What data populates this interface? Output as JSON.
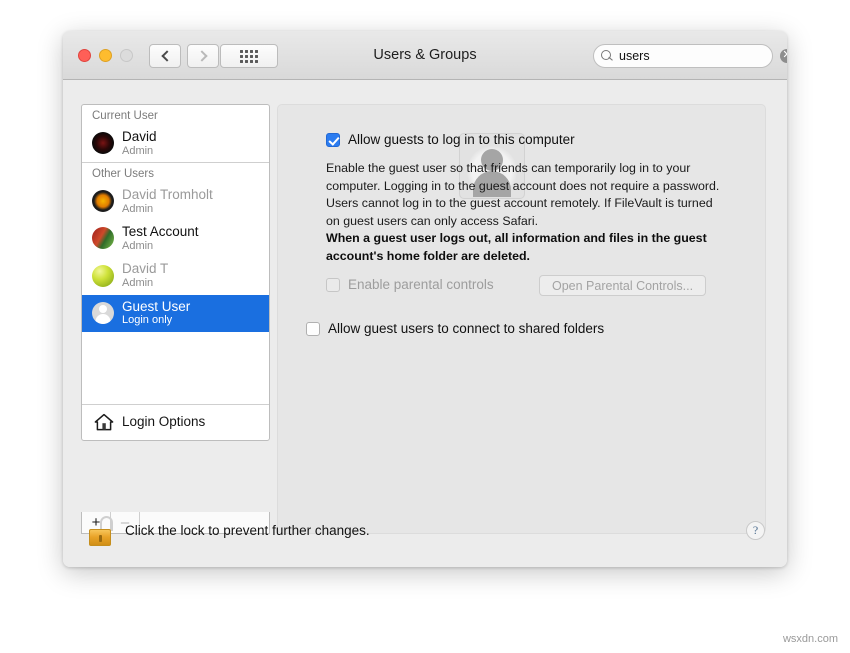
{
  "window": {
    "title": "Users & Groups",
    "traffic_lights": [
      "close",
      "minimize",
      "zoom"
    ]
  },
  "toolbar": {
    "back_label": "‹",
    "forward_label": "›",
    "show_all_label": "grid-icon",
    "search": {
      "value": "users",
      "placeholder": "Search",
      "clear_label": "✕"
    }
  },
  "sidebar": {
    "current_user_header": "Current User",
    "other_users_header": "Other Users",
    "current_user": {
      "name": "David",
      "role": "Admin",
      "avatar": "dark-sphere-avatar"
    },
    "other_users": [
      {
        "name": "David Tromholt",
        "role": "Admin",
        "avatar": "sunflower-avatar",
        "selected": false
      },
      {
        "name": "Test Account",
        "role": "Admin",
        "avatar": "photo-avatar",
        "selected": false
      },
      {
        "name": "David T",
        "role": "Admin",
        "avatar": "green-ball-avatar",
        "selected": false
      },
      {
        "name": "Guest User",
        "role": "Login only",
        "avatar": "guest-silhouette-avatar",
        "selected": true
      }
    ],
    "login_options_label": "Login Options",
    "add_button_label": "+",
    "remove_button_label": "–"
  },
  "main": {
    "avatar_alt": "guest-user-avatar",
    "allow_guests": {
      "label": "Allow guests to log in to this computer",
      "checked": true
    },
    "description": "Enable the guest user so that friends can temporarily log in to your computer. Logging in to the guest account does not require a password. Users cannot log in to the guest account remotely. If FileVault is turned on guest users can only access Safari.",
    "warning": "When a guest user logs out, all information and files in the guest account's home folder are deleted.",
    "parental_controls": {
      "label": "Enable parental controls",
      "checked": false,
      "disabled": true,
      "button_label": "Open Parental Controls..."
    },
    "shared_folders": {
      "label": "Allow guest users to connect to shared folders",
      "checked": false
    }
  },
  "footer": {
    "lock_state": "unlocked",
    "lock_text": "Click the lock to prevent further changes.",
    "help_label": "?"
  },
  "watermark": "wsxdn.com",
  "colors": {
    "accent": "#2b7cf0",
    "selection": "#1a6fe0",
    "window_bg": "#ececec",
    "pane_bg": "#e6e6e6"
  }
}
